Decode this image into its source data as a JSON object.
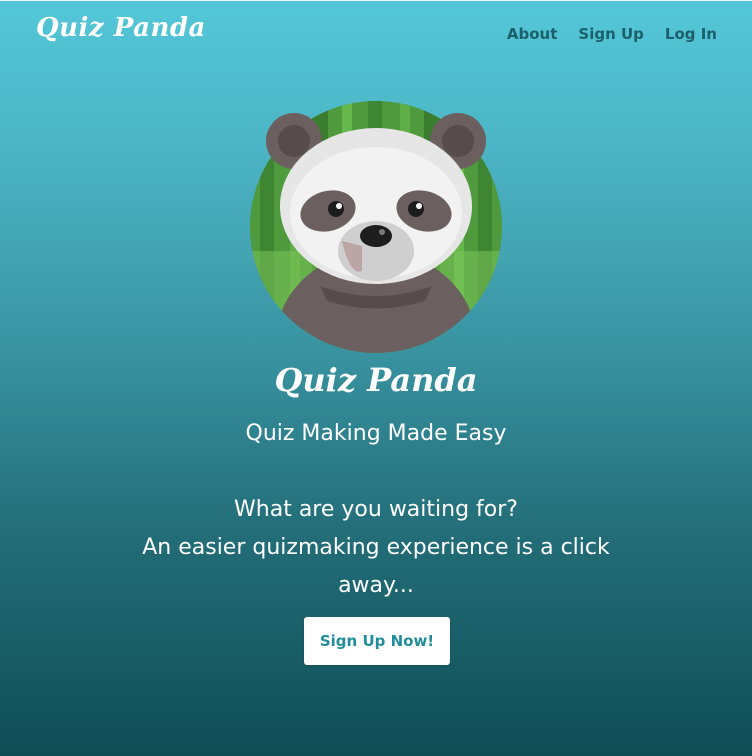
{
  "brand": {
    "name": "Quiz Panda"
  },
  "nav": {
    "items": [
      {
        "label": "About"
      },
      {
        "label": "Sign Up"
      },
      {
        "label": "Log In"
      }
    ]
  },
  "hero": {
    "image_icon": "panda-logo",
    "title": "Quiz Panda",
    "tagline": "Quiz Making Made Easy",
    "cta_line1": "What are you waiting for?",
    "cta_line2": "An easier quizmaking experience is a click away...",
    "button_label": "Sign Up Now!"
  },
  "colors": {
    "gradient_top": "#53c7d8",
    "gradient_bottom": "#0f4d55",
    "nav_link": "#1c5f6a",
    "button_text": "#1f8d9a",
    "text": "#ffffff"
  }
}
